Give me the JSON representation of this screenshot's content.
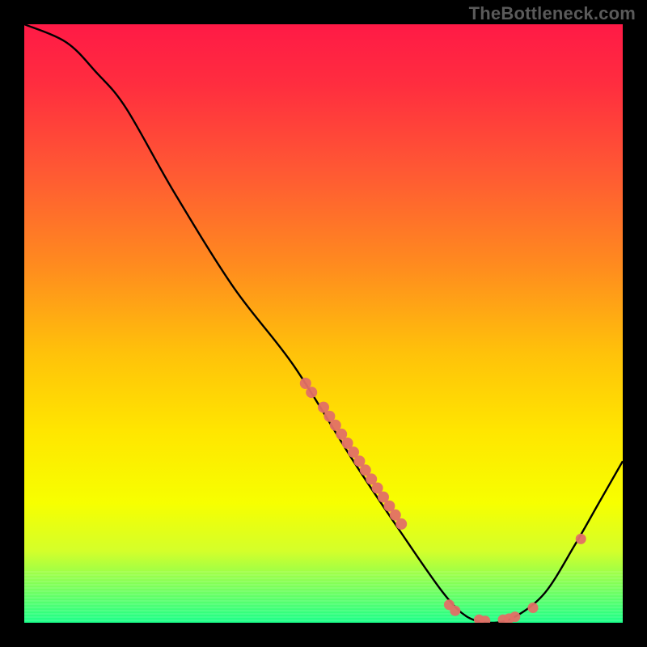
{
  "watermark": "TheBottleneck.com",
  "chart_data": {
    "type": "line",
    "title": "",
    "xlabel": "",
    "ylabel": "",
    "xlim": [
      0,
      100
    ],
    "ylim": [
      0,
      100
    ],
    "grid": false,
    "curve": [
      {
        "x": 0,
        "y": 100
      },
      {
        "x": 7,
        "y": 97
      },
      {
        "x": 12,
        "y": 92
      },
      {
        "x": 17,
        "y": 86
      },
      {
        "x": 25,
        "y": 72
      },
      {
        "x": 35,
        "y": 56
      },
      {
        "x": 45,
        "y": 43
      },
      {
        "x": 55,
        "y": 27
      },
      {
        "x": 63,
        "y": 15
      },
      {
        "x": 70,
        "y": 5
      },
      {
        "x": 74,
        "y": 1
      },
      {
        "x": 78,
        "y": 0
      },
      {
        "x": 82,
        "y": 1
      },
      {
        "x": 87,
        "y": 5
      },
      {
        "x": 92,
        "y": 13
      },
      {
        "x": 96,
        "y": 20
      },
      {
        "x": 100,
        "y": 27
      }
    ],
    "points_main_line": [
      {
        "x": 47,
        "y": 40
      },
      {
        "x": 48,
        "y": 38.5
      },
      {
        "x": 50,
        "y": 36
      },
      {
        "x": 51,
        "y": 34.5
      },
      {
        "x": 52,
        "y": 33
      },
      {
        "x": 53,
        "y": 31.5
      },
      {
        "x": 54,
        "y": 30
      },
      {
        "x": 55,
        "y": 28.5
      },
      {
        "x": 56,
        "y": 27
      },
      {
        "x": 57,
        "y": 25.5
      },
      {
        "x": 58,
        "y": 24
      },
      {
        "x": 59,
        "y": 22.5
      },
      {
        "x": 60,
        "y": 21
      },
      {
        "x": 61,
        "y": 19.5
      },
      {
        "x": 62,
        "y": 18
      },
      {
        "x": 63,
        "y": 16.5
      }
    ],
    "points_valley": [
      {
        "x": 71,
        "y": 3
      },
      {
        "x": 72,
        "y": 2
      },
      {
        "x": 76,
        "y": 0.5
      },
      {
        "x": 77,
        "y": 0.3
      },
      {
        "x": 80,
        "y": 0.5
      },
      {
        "x": 81,
        "y": 0.7
      },
      {
        "x": 82,
        "y": 1
      },
      {
        "x": 85,
        "y": 2.5
      }
    ],
    "points_right": [
      {
        "x": 93,
        "y": 14
      }
    ],
    "gradient_stops": [
      {
        "offset": 0.0,
        "color": "#ff1a46"
      },
      {
        "offset": 0.1,
        "color": "#ff2d3f"
      },
      {
        "offset": 0.25,
        "color": "#ff5a33"
      },
      {
        "offset": 0.4,
        "color": "#ff8a1f"
      },
      {
        "offset": 0.55,
        "color": "#ffc20a"
      },
      {
        "offset": 0.68,
        "color": "#ffe600"
      },
      {
        "offset": 0.8,
        "color": "#f7ff00"
      },
      {
        "offset": 0.88,
        "color": "#d4ff2a"
      },
      {
        "offset": 0.94,
        "color": "#7bff5a"
      },
      {
        "offset": 1.0,
        "color": "#1aff89"
      }
    ],
    "band_count": 16,
    "point_color": "#e27066",
    "curve_color": "#000000"
  }
}
